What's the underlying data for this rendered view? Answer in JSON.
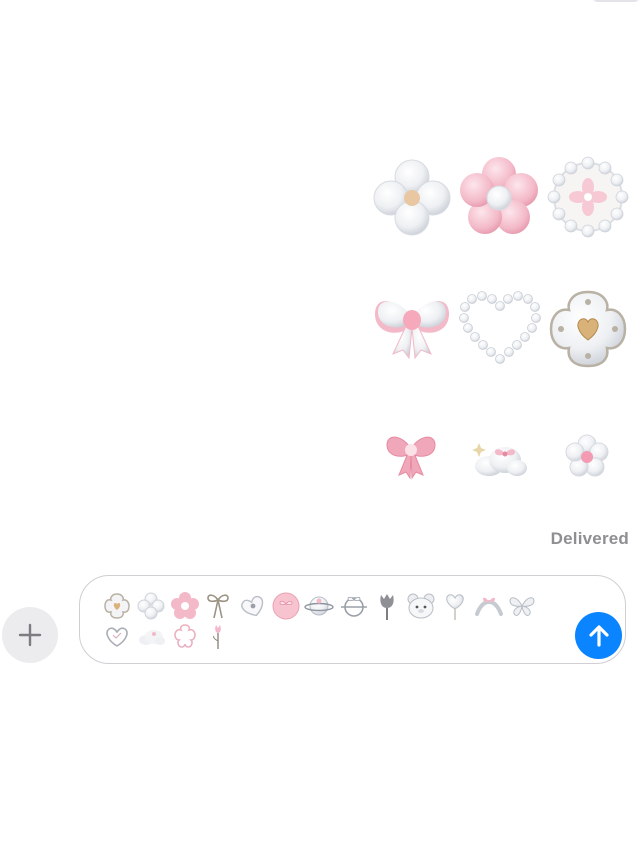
{
  "conversation": {
    "status_text": "Delivered",
    "stickers": [
      {
        "name": "clover-heart-sticker"
      },
      {
        "name": "pink-flower-sticker"
      },
      {
        "name": "pearl-flower-ring-sticker"
      },
      {
        "name": "white-bow-sticker"
      },
      {
        "name": "pearl-heart-sticker"
      },
      {
        "name": "gold-heart-quatrefoil-sticker"
      },
      {
        "name": "pink-bow-sticker"
      },
      {
        "name": "cloud-bow-sparkle-sticker"
      },
      {
        "name": "small-flower-sticker"
      }
    ]
  },
  "composer": {
    "attachments": [
      "quatrefoil-charm",
      "clover",
      "pink-flower",
      "ribbon-bow",
      "heart-charm",
      "pink-button",
      "planet-bow",
      "ring-bow",
      "tulip",
      "bear-face",
      "heart-balloon",
      "crossed-bow",
      "butterfly",
      "heart-outline",
      "cloud",
      "flower-outline",
      "tulip-stem"
    ]
  },
  "colors": {
    "send_button": "#0a84ff",
    "plus_button_bg": "#ececee",
    "delivered_text": "#8e8e93",
    "sticker_pink": "#f3b9c8",
    "sticker_pearl": "#eef0f3"
  }
}
